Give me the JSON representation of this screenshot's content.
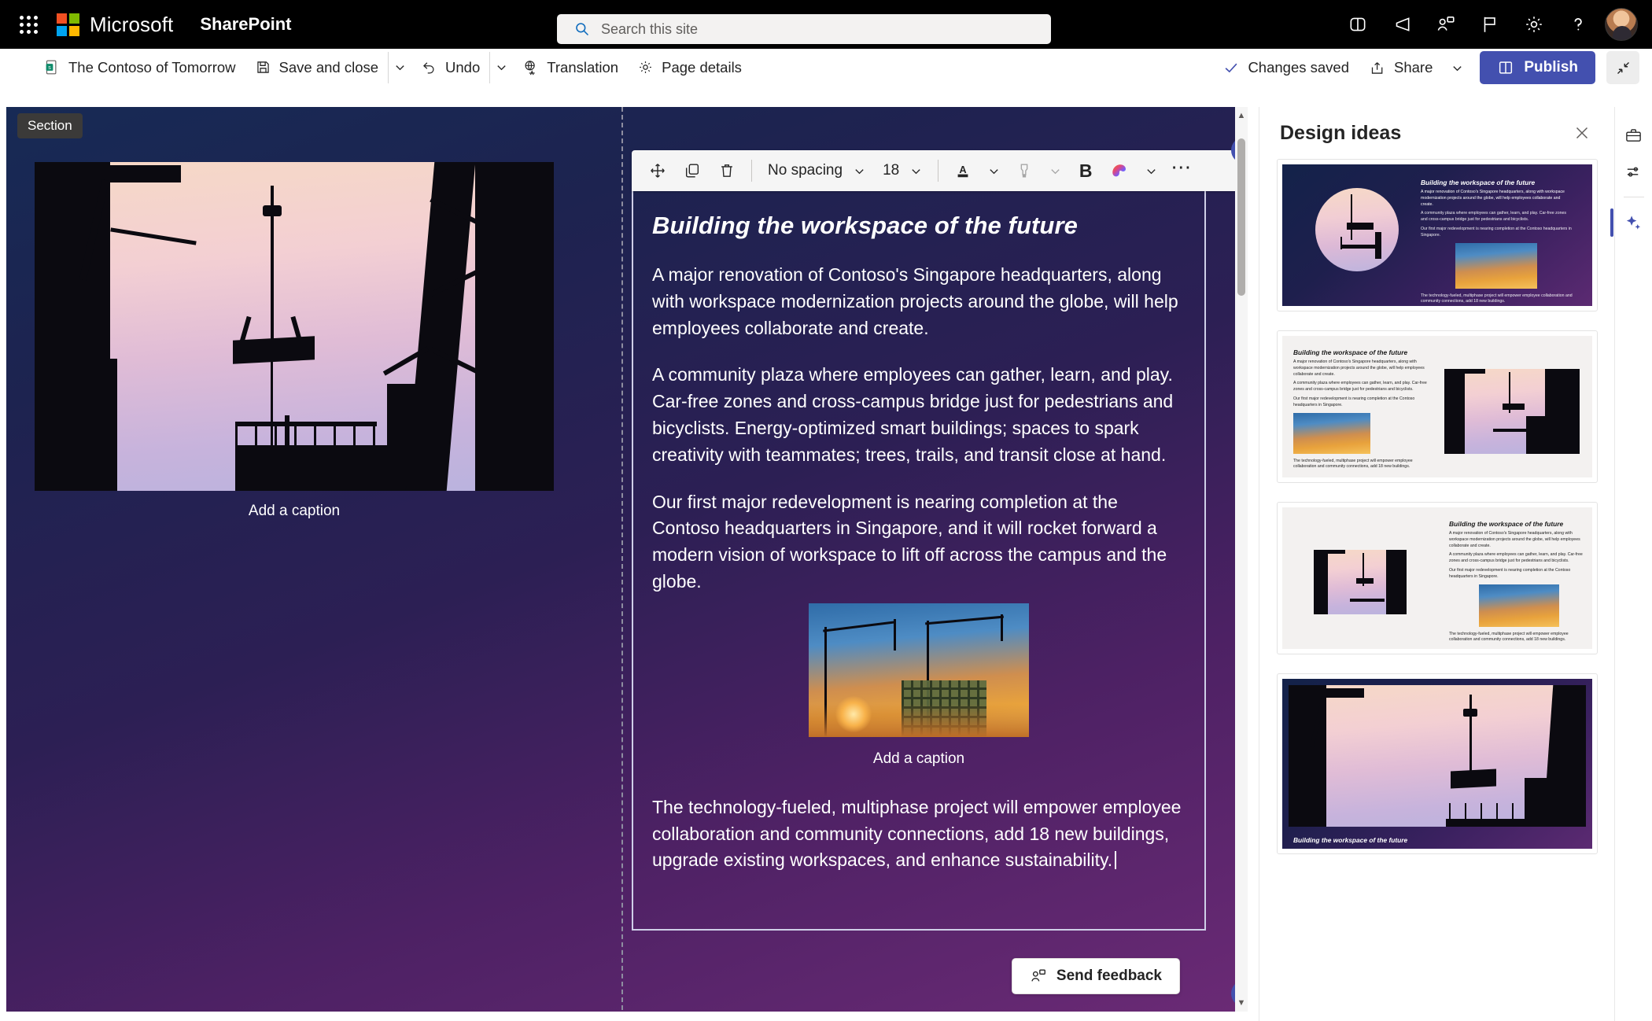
{
  "suite": {
    "brand": "Microsoft",
    "app_name": "SharePoint",
    "search_placeholder": "Search this site",
    "search_value": "",
    "icons": [
      "app-launcher-icon",
      "teams-icon",
      "megaphone-icon",
      "feedback-icon",
      "flag-icon",
      "settings-gear-icon",
      "help-icon",
      "avatar"
    ]
  },
  "command_bar": {
    "page_name": "The Contoso of Tomorrow",
    "save_and_close": "Save and close",
    "undo": "Undo",
    "translation": "Translation",
    "page_details": "Page details",
    "changes_saved": "Changes saved",
    "share": "Share",
    "publish": "Publish",
    "collapse_tooltip": "Collapse",
    "accent_color": "#4350af"
  },
  "canvas": {
    "section_label": "Section",
    "add_section_label": "+",
    "send_feedback": "Send feedback",
    "left_column": {
      "image_name": "construction-silhouette-dusk",
      "caption": "Add a caption"
    },
    "text_webpart": {
      "toolbar": {
        "move": "move-handle-icon",
        "duplicate": "duplicate-icon",
        "delete": "delete-icon",
        "style_value": "No spacing",
        "size_value": "18",
        "font_color": "font-color-icon",
        "highlight": "highlight-icon",
        "bold": "B",
        "copilot": "copilot-icon",
        "more": "more-options-icon"
      },
      "title": "Building the workspace of the future",
      "paragraphs": [
        "A major renovation of Contoso's Singapore headquarters, along with workspace modernization projects around the globe, will help employees collaborate and create.",
        "A community plaza where employees can gather, learn, and play. Car-free zones and cross-campus bridge just for pedestrians and bicyclists. Energy-optimized smart buildings; spaces to spark creativity with teammates; trees, trails, and transit close at hand.",
        "Our first major redevelopment is nearing completion at the Contoso headquarters in Singapore, and it will rocket forward a modern vision of workspace to lift off across the campus and the globe."
      ],
      "inline_image_caption": "Add a caption",
      "final_paragraph": "The technology-fueled, multiphase project will empower employee collaboration and community connections, add 18 new buildings, upgrade existing workspaces, and enhance sustainability."
    }
  },
  "design_panel": {
    "title": "Design ideas",
    "close_label": "✕",
    "ideas": [
      {
        "id": "idea-1",
        "layout": "dark-circle-left-text-right",
        "title": "Building the workspace of the future",
        "body": "A major renovation of Contoso's Singapore headquarters, along with workspace modernization projects around the globe, will help employees collaborate and create."
      },
      {
        "id": "idea-2",
        "layout": "light-text-left-image-right",
        "title": "Building the workspace of the future",
        "body": "A major renovation of Contoso's Singapore headquarters, along with workspace modernization projects around the globe, will help employees collaborate and create."
      },
      {
        "id": "idea-3",
        "layout": "light-image-left-text-right",
        "title": "Building the workspace of the future",
        "body": "A major renovation of Contoso's Singapore headquarters, along with workspace modernization projects around the globe, will help employees collaborate and create."
      },
      {
        "id": "idea-4",
        "layout": "hero-image-title-bottom",
        "title": "Building the workspace of the future",
        "body": ""
      }
    ]
  },
  "right_rail": {
    "items": [
      {
        "name": "toolbox-icon",
        "active": false
      },
      {
        "name": "page-settings-icon",
        "active": false
      },
      {
        "name": "design-ideas-sparkle-icon",
        "active": true
      }
    ]
  }
}
